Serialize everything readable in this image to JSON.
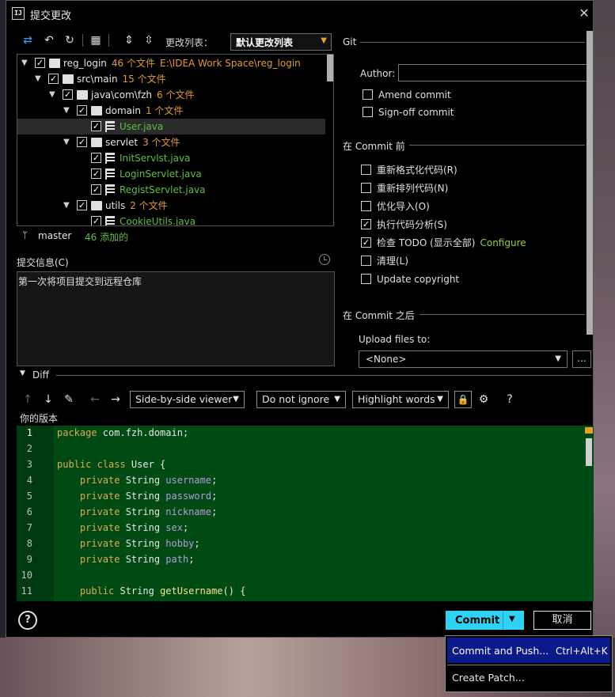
{
  "window": {
    "title": "提交更改",
    "icon": "intellij-icon",
    "close": "✕"
  },
  "toolbar": {
    "changelist_label": "更改列表：",
    "changelist_value": "默认更改列表"
  },
  "tree": {
    "rows": [
      {
        "name": "reg_login",
        "count": "46 个文件",
        "path": "E:\\IDEA Work Space\\reg_login"
      },
      {
        "name": "src\\main",
        "count": "15 个文件"
      },
      {
        "name": "java\\com\\fzh",
        "count": "6 个文件"
      },
      {
        "name": "domain",
        "count": "1 个文件"
      },
      {
        "name": "User.java"
      },
      {
        "name": "servlet",
        "count": "3 个文件"
      },
      {
        "name": "InitServlst.java"
      },
      {
        "name": "LoginServlet.java"
      },
      {
        "name": "RegistServlet.java"
      },
      {
        "name": "utils",
        "count": "2 个文件"
      },
      {
        "name": "CookieUtils.java"
      }
    ]
  },
  "branch": {
    "name": "master",
    "added": "46 添加的"
  },
  "commit_message": {
    "label": "提交信息(C)",
    "value": "第一次将项目提交到远程仓库"
  },
  "git": {
    "section_title": "Git",
    "author_label": "Author:",
    "author_value": "",
    "options": [
      {
        "label": "Amend commit",
        "checked": false
      },
      {
        "label": "Sign-off commit",
        "checked": false
      }
    ]
  },
  "before_commit": {
    "title": "在 Commit 前",
    "options": [
      {
        "label": "重新格式化代码(R)",
        "checked": false
      },
      {
        "label": "重新排列代码(N)",
        "checked": false
      },
      {
        "label": "优化导入(O)",
        "checked": false
      },
      {
        "label": "执行代码分析(S)",
        "checked": true
      },
      {
        "label": "检查 TODO (显示全部)",
        "checked": true,
        "link": "Configure"
      },
      {
        "label": "清理(L)",
        "checked": false
      },
      {
        "label": "Update copyright",
        "checked": false
      }
    ]
  },
  "after_commit": {
    "title": "在 Commit 之后",
    "upload_label": "Upload files to:",
    "upload_value": "<None>",
    "more": "..."
  },
  "diff": {
    "label": "Diff",
    "viewer": "Side-by-side viewer",
    "whitespace": "Do not ignore",
    "highlight": "Highlight words",
    "help": "?",
    "your_version": "你的版本"
  },
  "editor": {
    "lines": [
      {
        "n": "1",
        "cur": true,
        "tokens": [
          [
            "k",
            "package "
          ],
          [
            "t",
            "com.fzh.domain;"
          ]
        ]
      },
      {
        "n": "2",
        "tokens": []
      },
      {
        "n": "3",
        "tokens": [
          [
            "k",
            "public class "
          ],
          [
            "t",
            "User {"
          ]
        ]
      },
      {
        "n": "4",
        "tokens": [
          [
            "k",
            "    private "
          ],
          [
            "t",
            "String "
          ],
          [
            "f",
            "username"
          ],
          [
            "t",
            ";"
          ]
        ]
      },
      {
        "n": "5",
        "tokens": [
          [
            "k",
            "    private "
          ],
          [
            "t",
            "String "
          ],
          [
            "f",
            "password"
          ],
          [
            "t",
            ";"
          ]
        ]
      },
      {
        "n": "6",
        "tokens": [
          [
            "k",
            "    private "
          ],
          [
            "t",
            "String "
          ],
          [
            "f",
            "nickname"
          ],
          [
            "t",
            ";"
          ]
        ]
      },
      {
        "n": "7",
        "tokens": [
          [
            "k",
            "    private "
          ],
          [
            "t",
            "String "
          ],
          [
            "f",
            "sex"
          ],
          [
            "t",
            ";"
          ]
        ]
      },
      {
        "n": "8",
        "tokens": [
          [
            "k",
            "    private "
          ],
          [
            "t",
            "String "
          ],
          [
            "f",
            "hobby"
          ],
          [
            "t",
            ";"
          ]
        ]
      },
      {
        "n": "9",
        "tokens": [
          [
            "k",
            "    private "
          ],
          [
            "t",
            "String "
          ],
          [
            "f",
            "path"
          ],
          [
            "t",
            ";"
          ]
        ]
      },
      {
        "n": "10",
        "tokens": []
      },
      {
        "n": "11",
        "tokens": [
          [
            "k",
            "    public "
          ],
          [
            "t",
            "String "
          ],
          [
            "m",
            "getUsername"
          ],
          [
            "t",
            "() {"
          ]
        ]
      }
    ]
  },
  "footer": {
    "help": "?",
    "commit": "Commit",
    "cancel": "取消"
  },
  "popup": {
    "items": [
      {
        "label": "Commit and Push...",
        "shortcut": "Ctrl+Alt+K"
      },
      {
        "label": "Create Patch..."
      }
    ]
  },
  "colors": {
    "accent": "#2fd2f2",
    "count_orange": "#e09a2d",
    "added_green": "#5fbf3f",
    "editor_bg": "#004a14",
    "popup_selected": "#0b1a8a"
  }
}
